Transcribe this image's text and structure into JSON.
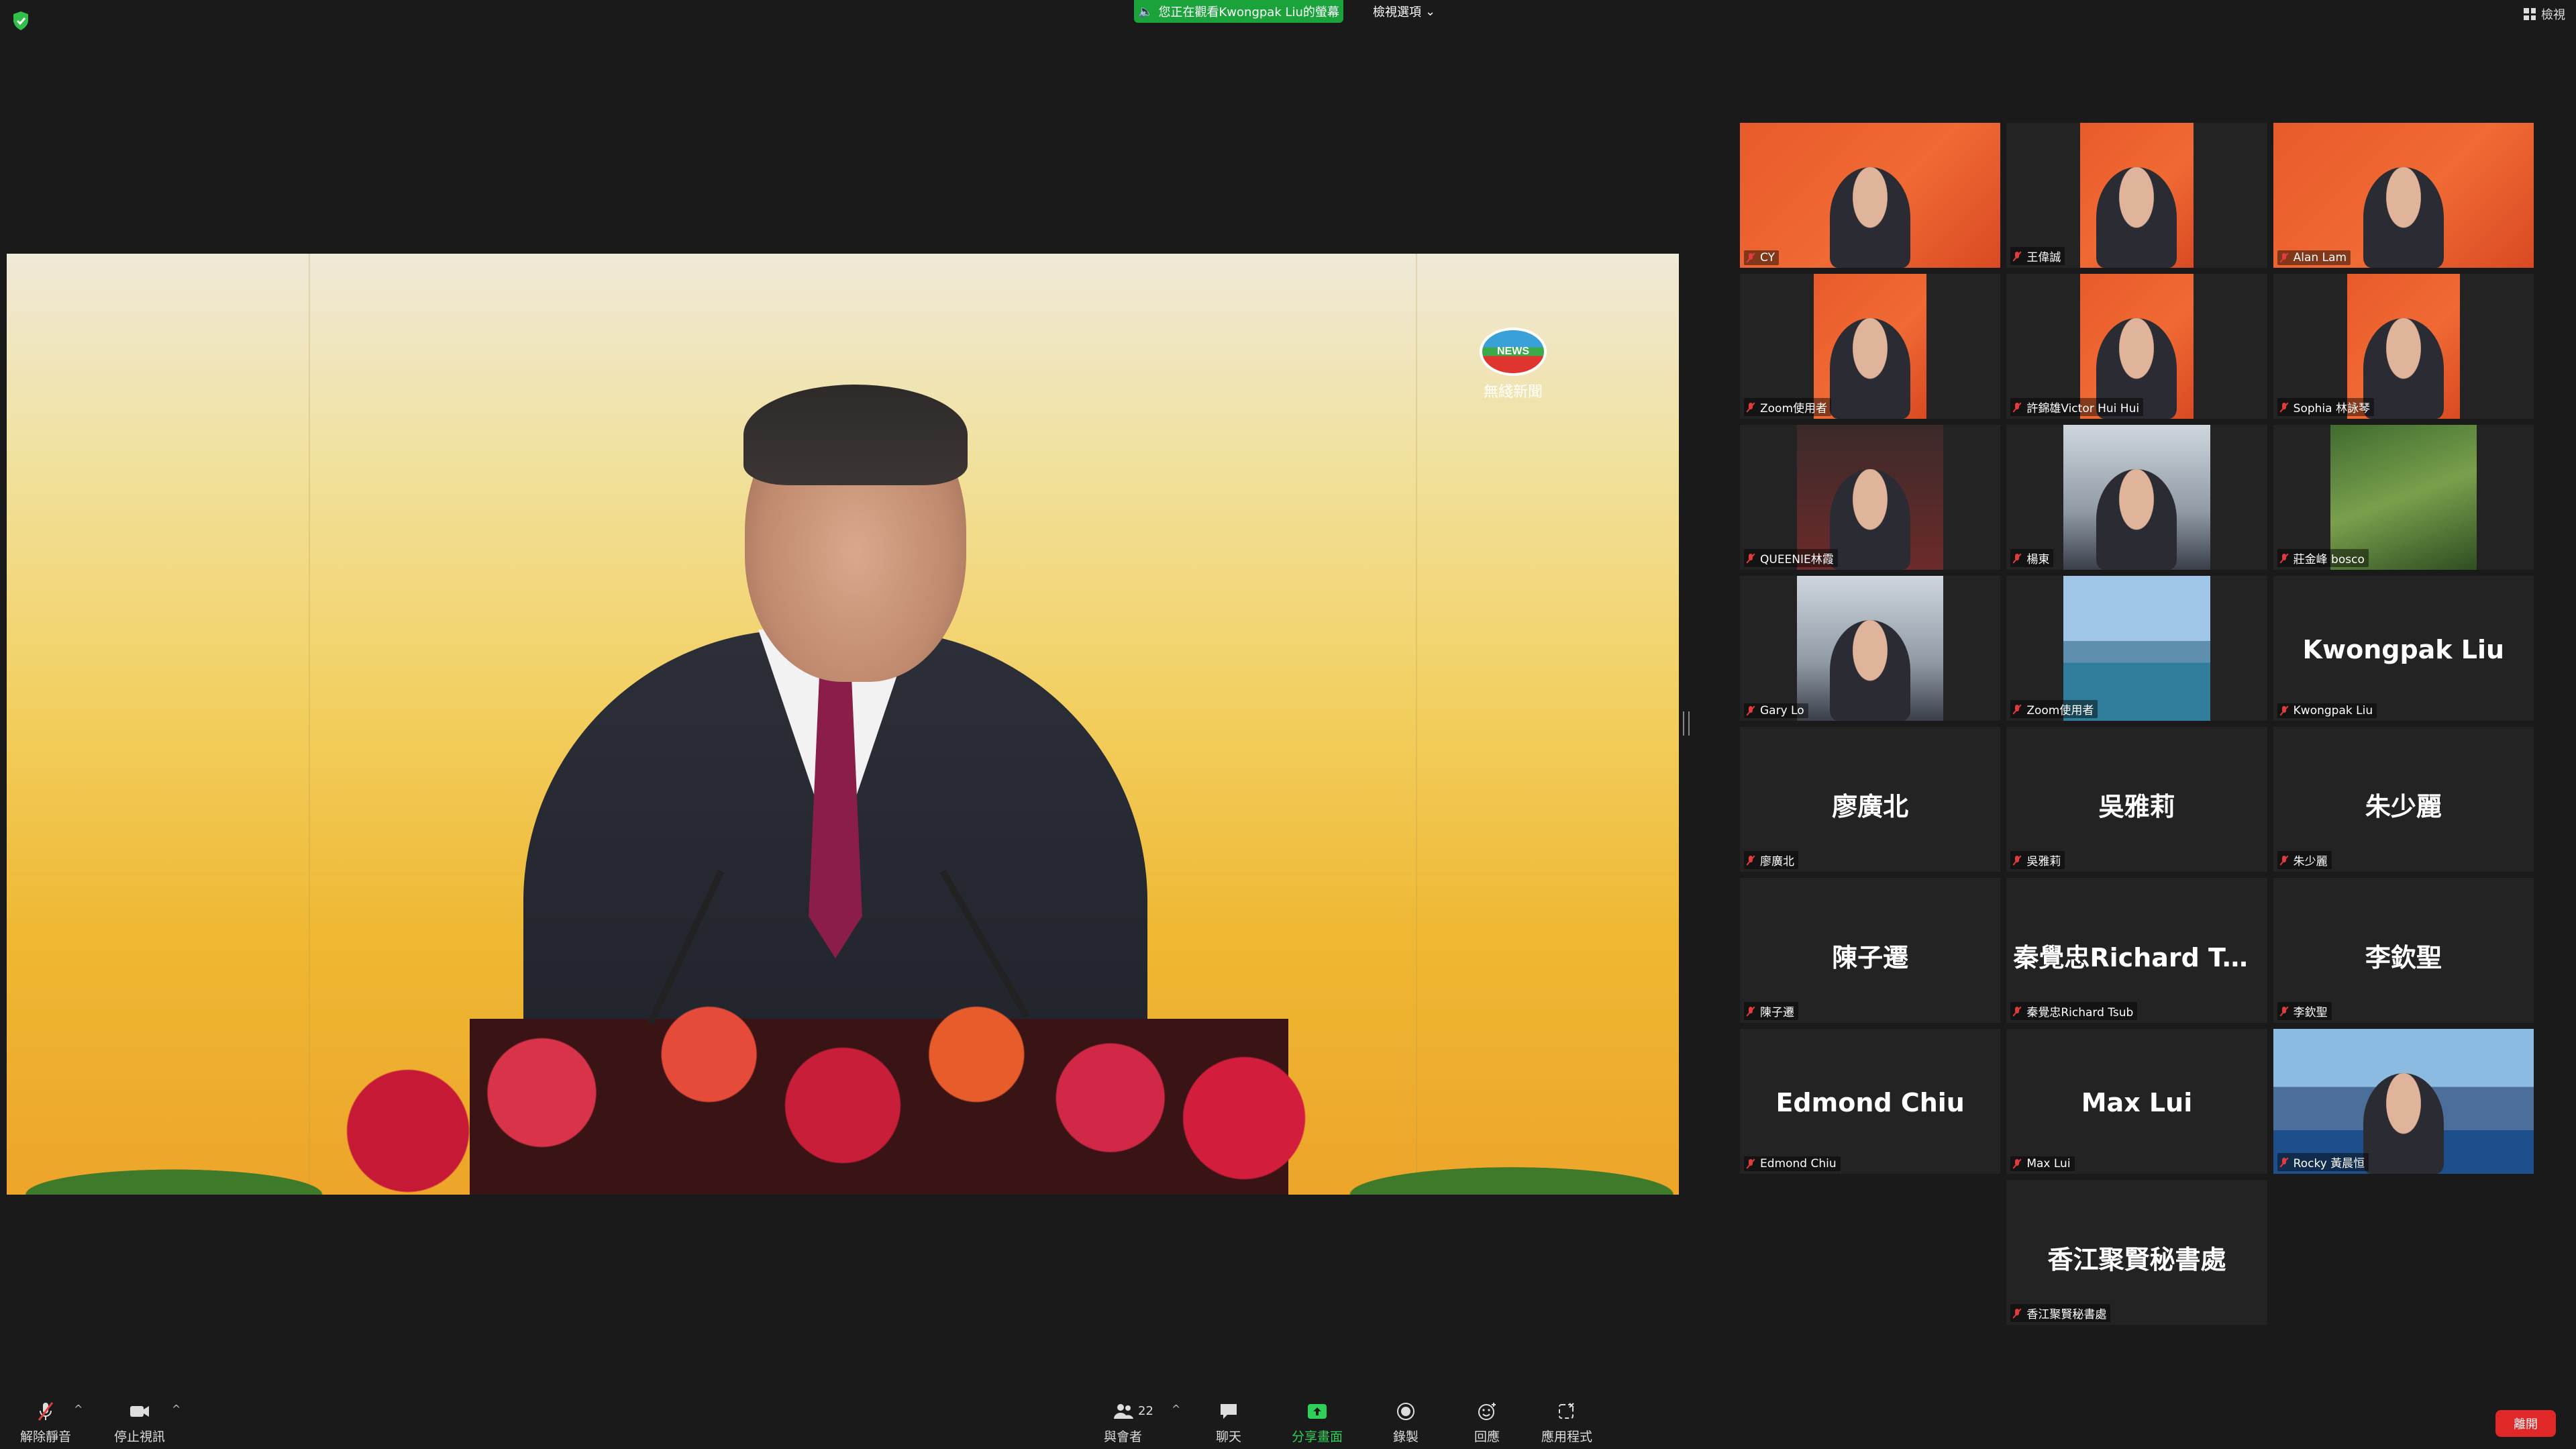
{
  "top": {
    "banner": "您正在觀看Kwongpak Liu的螢幕",
    "view_options": "檢視選項",
    "view_toggle": "檢視"
  },
  "share": {
    "news_logo": "NEWS",
    "news_sub": "無綫新聞"
  },
  "participants": [
    {
      "name": "CY",
      "display": "",
      "video": "red"
    },
    {
      "name": "王偉誠",
      "display": "",
      "video": "red"
    },
    {
      "name": "Alan Lam",
      "display": "",
      "video": "red"
    },
    {
      "name": "Zoom使用者",
      "display": "",
      "video": "red"
    },
    {
      "name": "許錦雄Victor Hui Hui",
      "display": "",
      "video": "red"
    },
    {
      "name": "Sophia 林詠琴",
      "display": "",
      "video": "red"
    },
    {
      "name": "QUEENIE林霞",
      "display": "",
      "video": "dark"
    },
    {
      "name": "楊東",
      "display": "",
      "video": "office"
    },
    {
      "name": "莊金峰 bosco",
      "display": "",
      "video": "tree"
    },
    {
      "name": "Gary Lo",
      "display": "",
      "video": "portrait"
    },
    {
      "name": "Zoom使用者",
      "display": "",
      "video": "bridge"
    },
    {
      "name": "Kwongpak Liu",
      "display": "Kwongpak Liu",
      "video": "none"
    },
    {
      "name": "廖廣北",
      "display": "廖廣北",
      "video": "none"
    },
    {
      "name": "吳雅莉",
      "display": "吳雅莉",
      "video": "none"
    },
    {
      "name": "朱少麗",
      "display": "朱少麗",
      "video": "none"
    },
    {
      "name": "陳子遷",
      "display": "陳子遷",
      "video": "none"
    },
    {
      "name": "秦覺忠Richard Tsub",
      "display": "秦覺忠Richard Ts...",
      "video": "none"
    },
    {
      "name": "李欽聖",
      "display": "李欽聖",
      "video": "none"
    },
    {
      "name": "Edmond Chiu",
      "display": "Edmond Chiu",
      "video": "none"
    },
    {
      "name": "Max Lui",
      "display": "Max Lui",
      "video": "none"
    },
    {
      "name": "Rocky 黃晨恒",
      "display": "",
      "video": "city"
    },
    {
      "name": "",
      "display": "",
      "video": "empty"
    },
    {
      "name": "香江聚賢秘書處",
      "display": "香江聚賢秘書處",
      "video": "none"
    }
  ],
  "toolbar": {
    "unmute": "解除靜音",
    "stop_video": "停止視訊",
    "participants": "與會者",
    "participant_count": "22",
    "chat": "聊天",
    "share_screen": "分享畫面",
    "record": "錄製",
    "reactions": "回應",
    "apps": "應用程式",
    "leave": "離開"
  },
  "colors": {
    "share_green": "#2fd05a",
    "banner_green": "#1aa33a",
    "leave_red": "#e02828",
    "active_speaker": "#c7d64a"
  }
}
